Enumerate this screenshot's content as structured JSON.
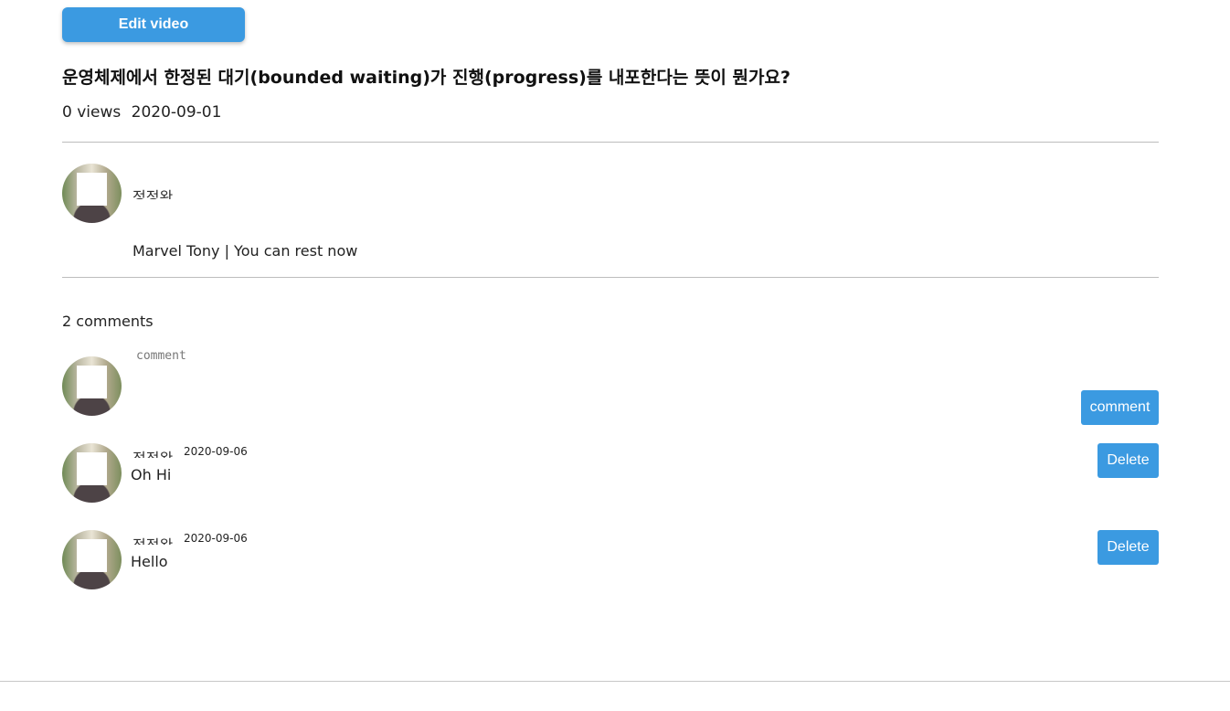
{
  "toolbar": {
    "edit_label": "Edit video"
  },
  "video": {
    "title": "운영체제에서 한정된 대기(bounded waiting)가 진행(progress)를 내포한다는 뜻이 뭔가요?",
    "views": "0 views",
    "date": "2020-09-01",
    "uploader_name": "정정완",
    "description": "Marvel Tony | You can rest now"
  },
  "comments_section": {
    "count_text": "2 comments",
    "input_placeholder": "comment",
    "submit_label": "comment",
    "items": [
      {
        "author": "정정완",
        "date": "2020-09-06",
        "text": "Oh Hi",
        "delete_label": "Delete"
      },
      {
        "author": "정정완",
        "date": "2020-09-06",
        "text": "Hello",
        "delete_label": "Delete"
      }
    ]
  },
  "colors": {
    "accent": "#3b9ae1",
    "divider": "#bdbdbd"
  }
}
